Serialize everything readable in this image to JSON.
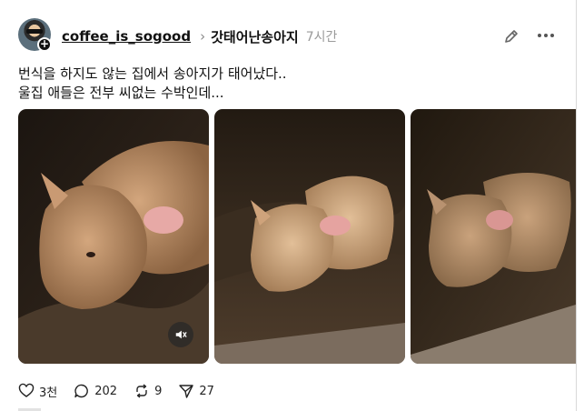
{
  "post": {
    "username": "coffee_is_sogood",
    "community": "갓태어난송아지",
    "time": "7시간",
    "text": "번식을 하지도 않는 집에서 송아지가 태어났다..\n울집 애들은 전부 씨없는 수박인데..."
  },
  "media": {
    "items": [
      "photo-1",
      "photo-2",
      "photo-3"
    ]
  },
  "actions": {
    "likes": "3천",
    "comments": "202",
    "reposts": "9",
    "shares": "27"
  },
  "icons": [
    "avatar-plus-icon",
    "chevron-right-icon",
    "edit-icon",
    "more-icon",
    "mute-icon",
    "heart-icon",
    "comment-icon",
    "repost-icon",
    "share-icon"
  ]
}
